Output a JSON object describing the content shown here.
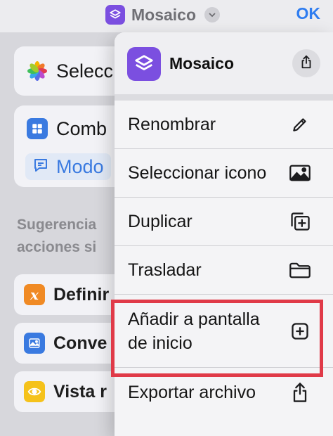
{
  "topbar": {
    "app_title": "Mosaico",
    "ok_label": "OK",
    "title_icon": "layers-icon",
    "chevron_icon": "chevron-down-icon"
  },
  "background": {
    "card1": {
      "label": "Selecc",
      "icon": "photos-icon"
    },
    "card2": {
      "label": "Comb",
      "icon": "grid-icon",
      "sub_label": "Modo",
      "sub_icon": "message-icon"
    },
    "section_title_line1": "Sugerencia",
    "section_title_line2": "acciones si",
    "actions": [
      {
        "label": "Definir",
        "icon": "variable-icon",
        "color": "#f08a24"
      },
      {
        "label": "Conve",
        "icon": "image-icon",
        "color": "#3a7ae0"
      },
      {
        "label": "Vista r",
        "icon": "eye-icon",
        "color": "#f5c21b"
      }
    ]
  },
  "menu": {
    "title": "Mosaico",
    "share_icon": "share-icon",
    "items": [
      {
        "label": "Renombrar",
        "icon": "pencil-icon"
      },
      {
        "label": "Seleccionar icono",
        "icon": "image-icon"
      },
      {
        "label": "Duplicar",
        "icon": "duplicate-icon"
      },
      {
        "label": "Trasladar",
        "icon": "folder-icon"
      },
      {
        "label": "Añadir a pantalla de inicio",
        "icon": "add-square-icon"
      },
      {
        "label": "Exportar archivo",
        "icon": "export-icon"
      }
    ]
  },
  "colors": {
    "accent": "#2f7df0",
    "app_purple": "#7b4fe0",
    "highlight": "#e03a48"
  }
}
